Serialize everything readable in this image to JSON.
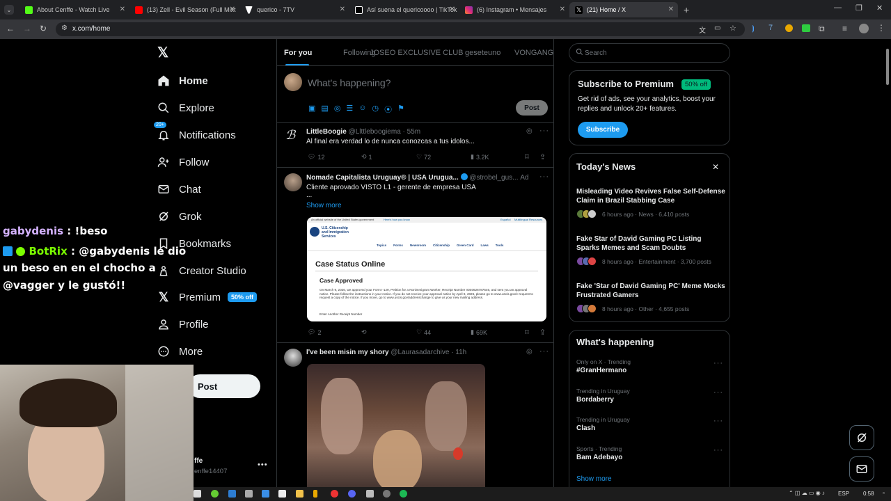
{
  "browser": {
    "tabs": [
      {
        "title": "About Cenffe - Watch Live",
        "icon_color": "#53fc18"
      },
      {
        "title": "(13) Zell - Evil Season (Full Mixt",
        "icon_color": "#ff0000"
      },
      {
        "title": "querico - 7TV",
        "icon_color": "#ffffff"
      },
      {
        "title": "Así suena el quericoooo | TikTok",
        "icon_color": "#ffffff"
      },
      {
        "title": "(6) Instagram • Mensajes",
        "icon_color": "#e1306c"
      },
      {
        "title": "(21) Home / X",
        "icon_color": "#ffffff"
      }
    ],
    "url": "x.com/home"
  },
  "overlay_chat": [
    {
      "user": "gabydenis",
      "message": ": !beso",
      "user_color": "#d5b3ff"
    },
    {
      "user": "BotRix",
      "message": ": @gabydenis le dio",
      "user_color": "#7cff00"
    },
    {
      "line": "un beso en en el chocho a"
    },
    {
      "line": "@vagger y le gustó!!"
    }
  ],
  "sidebar": {
    "items": [
      {
        "label": "Home",
        "icon": "home-icon"
      },
      {
        "label": "Explore",
        "icon": "search-icon"
      },
      {
        "label": "Notifications",
        "icon": "bell-icon",
        "badge": "20+"
      },
      {
        "label": "Follow",
        "icon": "follow-icon"
      },
      {
        "label": "Chat",
        "icon": "mail-icon"
      },
      {
        "label": "Grok",
        "icon": "grok-icon"
      },
      {
        "label": "Bookmarks",
        "icon": "bookmark-icon"
      },
      {
        "label": "Creator Studio",
        "icon": "creator-icon"
      },
      {
        "label": "Premium",
        "icon": "x-logo-icon",
        "badge": "50% off"
      },
      {
        "label": "Profile",
        "icon": "person-icon"
      },
      {
        "label": "More",
        "icon": "more-circle-icon"
      }
    ],
    "post_label": "Post",
    "account_name": "ffe",
    "account_handle": "enffe14407"
  },
  "feed": {
    "tabs": [
      "For you",
      "Following",
      "JOSEO EXCLUSIVE CLUB",
      "geseteuno",
      "VONGANG"
    ],
    "composer_placeholder": "What's happening?",
    "composer_post": "Post",
    "tweets": [
      {
        "name": "LittleBoogie",
        "handle": "@Llttleboogiema · 55m",
        "text": "Al final era verdad lo de nunca conozcas a tus idolos...",
        "replies": "12",
        "reposts": "1",
        "likes": "72",
        "views": "3.2K"
      },
      {
        "name": "Nomade Capitalista Uruguay® | USA Urugua...",
        "handle": "@strobel_gus...",
        "ad": "Ad",
        "text": "Cliente aprovado VISTO L1 - gerente de empresa USA",
        "text2": "...",
        "show_more": "Show more",
        "card": {
          "gov_banner": "An official website of the United States government",
          "gov_link": "Here's how you know",
          "agency_line1": "U.S. Citizenship",
          "agency_line2": "and Immigration",
          "agency_line3": "Services",
          "nav": [
            "Topics",
            "Forms",
            "Newsroom",
            "Citizenship",
            "Green Card",
            "Laws",
            "Tools"
          ],
          "top_links": [
            "Español",
            "Multilingual Resources"
          ],
          "heading": "Case Status Online",
          "status": "Case Approved",
          "body": "On March 9, 2026, we approved your Form I-129, Petition for a Nonimmigrant Worker, Receipt Number IOE0626787546, and sent you an approval notice. Please follow the instructions in your notice. If you do not receive your approval notice by April 8, 2026, please go to www.uscis.gov/e-request to request a copy of the notice. If you move, go to www.uscis.gov/addresschange to give us your new mailing address.",
          "receipt_label": "Enter Another Receipt Number"
        },
        "replies": "2",
        "reposts": "",
        "likes": "44",
        "views": "69K"
      },
      {
        "name": "I've been misin my shory",
        "handle": "@Laurasadarchive · 11h"
      }
    ]
  },
  "right": {
    "search_placeholder": "Search",
    "premium": {
      "title": "Subscribe to Premium",
      "badge": "50% off",
      "desc": "Get rid of ads, see your analytics, boost your replies and unlock 20+ features.",
      "button": "Subscribe"
    },
    "news": {
      "title": "Today's News",
      "items": [
        {
          "headline": "Misleading Video Revives False Self-Defense Claim in Brazil Stabbing Case",
          "meta": "6 hours ago · News · 6,410 posts"
        },
        {
          "headline": "Fake Star of David Gaming PC Listing Sparks Memes and Scam Doubts",
          "meta": "8 hours ago · Entertainment · 3,700 posts"
        },
        {
          "headline": "Fake 'Star of David Gaming PC' Meme Mocks Frustrated Gamers",
          "meta": "8 hours ago · Other · 4,655 posts"
        }
      ]
    },
    "trends": {
      "title": "What's happening",
      "items": [
        {
          "context": "Only on X · Trending",
          "name": "#GranHermano"
        },
        {
          "context": "Trending in Uruguay",
          "name": "Bordaberry"
        },
        {
          "context": "Trending in Uruguay",
          "name": "Clash"
        },
        {
          "context": "Sports · Trending",
          "name": "Bam Adebayo"
        }
      ],
      "show_more": "Show more"
    }
  },
  "taskbar": {
    "lang": "ESP",
    "time": "0:58"
  }
}
